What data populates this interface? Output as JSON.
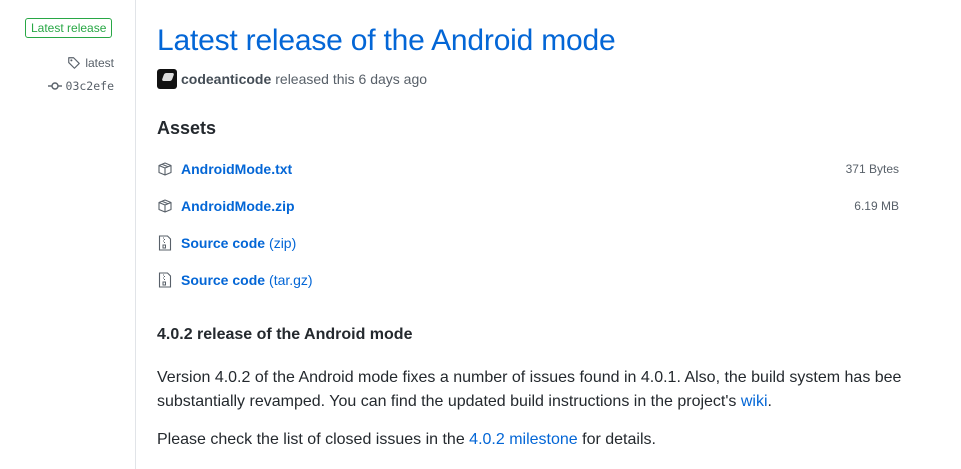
{
  "sidebar": {
    "badge": "Latest release",
    "tag_label": "latest",
    "commit": "03c2efe",
    "icons": {
      "tag": "tag-icon",
      "commit": "git-commit-icon"
    }
  },
  "release": {
    "title": "Latest release of the Android mode",
    "author": "codeanticode",
    "released_text": "released this 6 days ago"
  },
  "assets": {
    "heading": "Assets",
    "items": [
      {
        "name": "AndroidMode.txt",
        "suffix": "",
        "size": "371 Bytes",
        "icon": "package-icon"
      },
      {
        "name": "AndroidMode.zip",
        "suffix": "",
        "size": "6.19 MB",
        "icon": "package-icon"
      },
      {
        "name": "Source code",
        "suffix": "(zip)",
        "size": "",
        "icon": "file-zip-icon"
      },
      {
        "name": "Source code",
        "suffix": "(tar.gz)",
        "size": "",
        "icon": "file-zip-icon"
      }
    ]
  },
  "notes": {
    "heading": "4.0.2 release of the Android mode",
    "p1_text": "Version 4.0.2 of the Android mode fixes a number of issues found in 4.0.1. Also, the build system has bee substantially revamped. You can find the updated build instructions in the project's",
    "p1_link": "wiki",
    "p1_end": ".",
    "p2_text": "Please check the list of closed issues in the",
    "p2_link": "4.0.2 milestone",
    "p2_end": "for details."
  },
  "colors": {
    "link": "#0366d6",
    "badge": "#28a745",
    "text": "#24292e",
    "muted": "#586069"
  }
}
